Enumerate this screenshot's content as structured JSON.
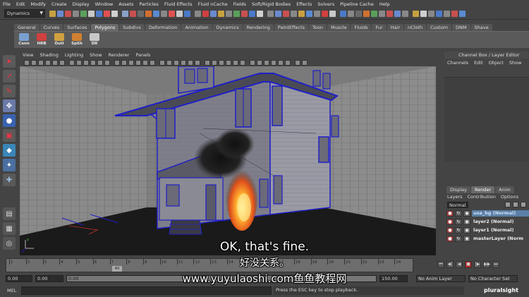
{
  "menubar": [
    "File",
    "Edit",
    "Modify",
    "Create",
    "Display",
    "Window",
    "Assets",
    "Particles",
    "Fluid Effects",
    "Fluid nCache",
    "Fields",
    "Soft/Rigid Bodies",
    "Effects",
    "Solvers",
    "Pipeline Cache",
    "Help"
  ],
  "statusline": {
    "mode": "Dynamics"
  },
  "shelf": {
    "tabs": [
      "General",
      "Curves",
      "Surfaces",
      "Polygons",
      "Subdivs",
      "Deformation",
      "Animation",
      "Dynamics",
      "Rendering",
      "PaintEffects",
      "Toon",
      "Muscle",
      "Fluids",
      "Fur",
      "Hair",
      "nCloth",
      "Custom",
      "DNM",
      "Shave"
    ],
    "active_tab": "Polygons",
    "buttons": [
      "Conn",
      "HRB",
      "Outl",
      "SpSh",
      "DR"
    ]
  },
  "viewport": {
    "menu": [
      "View",
      "Shading",
      "Lighting",
      "Show",
      "Renderer",
      "Panels"
    ]
  },
  "channel_box": {
    "title": "Channel Box / Layer Editor",
    "menu": [
      "Channels",
      "Edit",
      "Object",
      "Show"
    ]
  },
  "layer_editor": {
    "tabs": [
      "Display",
      "Render",
      "Anim"
    ],
    "active_tab": "Render",
    "menu": [
      "Layers",
      "Contribution",
      "Options"
    ],
    "blend_mode": "Normal",
    "layers": [
      {
        "name": "use_bg (Normal)",
        "selected": true
      },
      {
        "name": "layer2 (Normal)",
        "selected": false
      },
      {
        "name": "layer1 (Normal)",
        "selected": false
      },
      {
        "name": "masterLayer (Norm",
        "selected": false
      }
    ]
  },
  "timeslider": {
    "ticks": [
      "1",
      "2",
      "3",
      "4",
      "5",
      "6",
      "7",
      "8",
      "9",
      "10",
      "11",
      "12",
      "13",
      "14",
      "15",
      "16",
      "17",
      "18",
      "19",
      "20",
      "21",
      "22",
      "23",
      "24"
    ],
    "current_frame": "40"
  },
  "rangeslider": {
    "start": "0.00",
    "start2": "0.00",
    "playback_start": "0.00",
    "end": "150.00",
    "anim_layer": "No Anim Layer",
    "char_set": "No Character Set"
  },
  "cmdline": {
    "label": "MEL",
    "help": "Press the ESC key to stop playback."
  },
  "brand": "pluralsight",
  "subtitles": {
    "en": "OK, that's fine.",
    "cn": "好没关系。",
    "url": "www.yuyulaoshi.com鱼鱼教程网"
  },
  "colors": {
    "wire": "#1f1fc8",
    "bg": "#444444",
    "selection": "#5b7fa6"
  }
}
